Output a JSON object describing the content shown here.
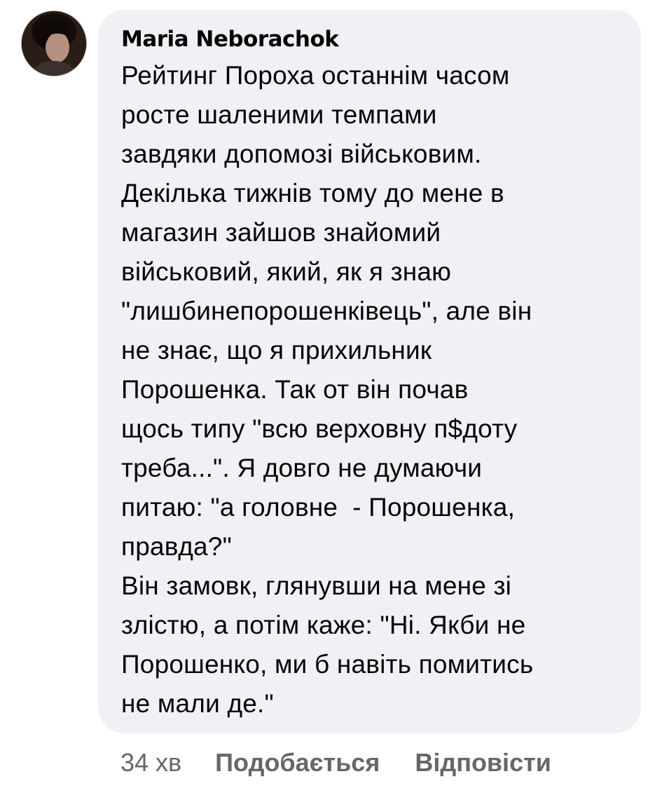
{
  "comment": {
    "author": "Maria Neborachok",
    "avatar_icon": "user-avatar-photo",
    "text_lines": [
      "Рейтинг Пороха останнім часом",
      "росте шаленими темпами",
      "завдяки допомозі військовим.",
      "Декілька тижнів тому до мене в",
      "магазин зайшов знайомий",
      "військовий, який, як я знаю",
      "\"лишбинепорошенківець\", але він",
      "не знає, що я прихильник",
      "Порошенка. Так от він почав",
      "щось типу \"всю верховну п$доту",
      "треба...\". Я довго не думаючи",
      "питаю: \"а головне  - Порошенка,",
      "правда?\"",
      "Він замовк, глянувши на мене зі",
      "злістю, а потім каже: \"Ні. Якби не",
      "Порошенко, ми б навіть помитись",
      "не мали де.\""
    ]
  },
  "meta": {
    "time": "34 хв",
    "like_label": "Подобається",
    "reply_label": "Відповісти"
  },
  "colors": {
    "bubble_bg": "#eff1f4",
    "text": "#050505",
    "meta_text": "#65676b"
  }
}
